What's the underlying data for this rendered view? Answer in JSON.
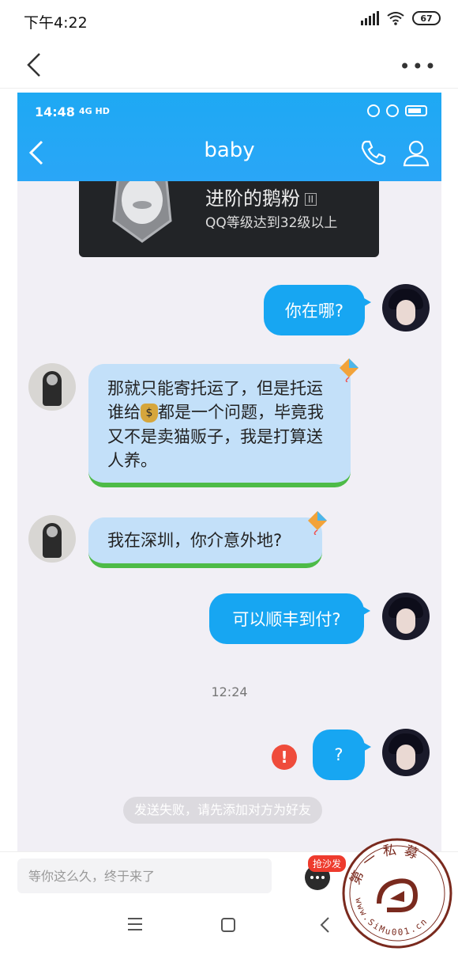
{
  "outer_status": {
    "time": "下午4:22",
    "battery": "67"
  },
  "inner_status": {
    "time": "14:48",
    "network": "4G HD"
  },
  "chat": {
    "title": "baby",
    "level_card": {
      "title": "进阶的鹅粉",
      "roman": "II",
      "description": "QQ等级达到32级以上"
    },
    "messages": [
      {
        "side": "me",
        "text": "你在哪?"
      },
      {
        "side": "them",
        "text_before": "那就只能寄托运了，但是托运谁给",
        "text_after": "都是一个问题，毕竟我又不是卖猫贩子，我是打算送人养。"
      },
      {
        "side": "them",
        "text": "我在深圳，你介意外地?"
      },
      {
        "side": "me",
        "text": "可以顺丰到付?"
      },
      {
        "side": "me",
        "text": "?",
        "failed": true
      }
    ],
    "timestamp": "12:24",
    "system_message": "发送失败，请先添加对方为好友"
  },
  "input": {
    "placeholder": "等你这么久，终于来了",
    "badge": "抢沙发"
  },
  "watermark": {
    "text": "第一私募",
    "url": "www.SiMu001.cn"
  },
  "colors": {
    "accent": "#17a6f2",
    "them_bubble": "#c3e0f9",
    "error": "#ef4c3b"
  }
}
